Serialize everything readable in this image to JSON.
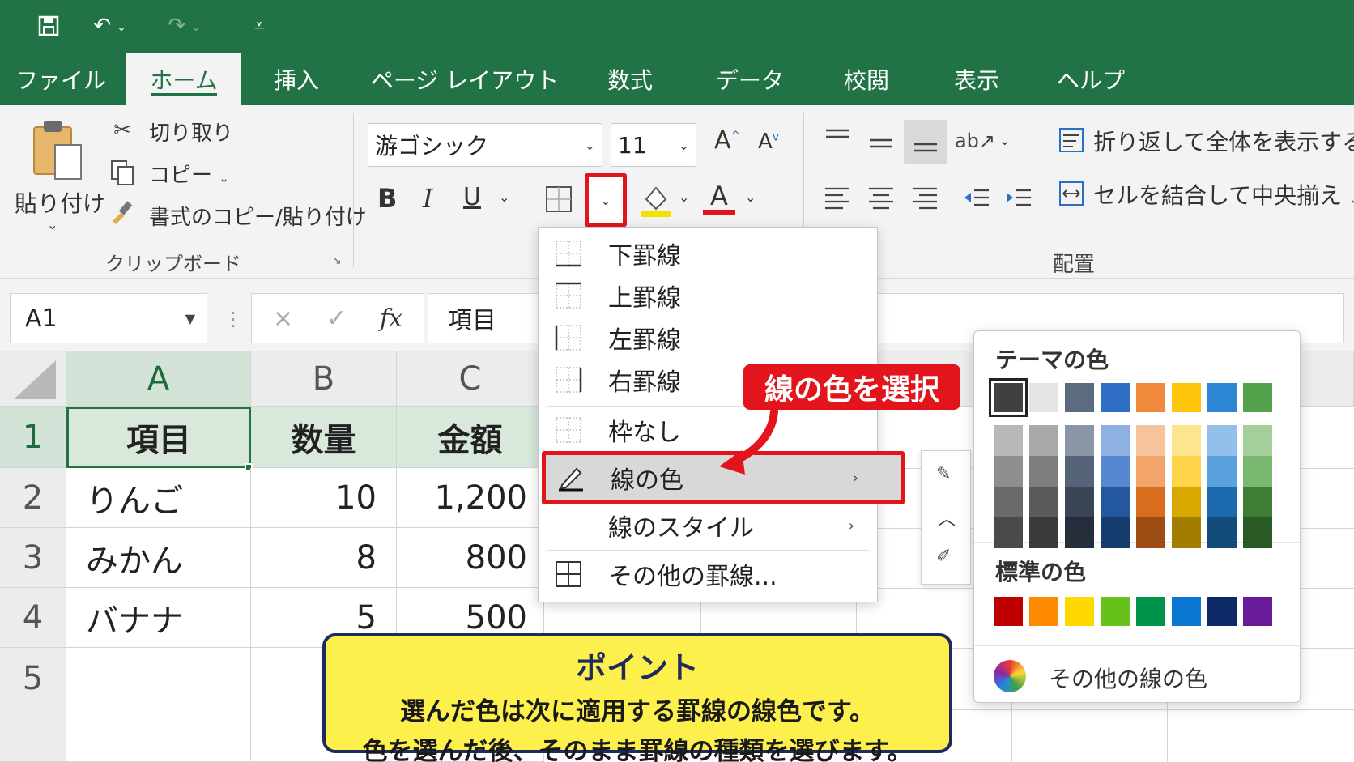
{
  "window": {
    "qat": {
      "save_icon": "save-icon",
      "undo_icon": "undo-icon",
      "redo_icon": "redo-icon",
      "customize_icon": "customize-qat-icon"
    },
    "brand_color": "#217346"
  },
  "tabs": [
    "ファイル",
    "ホーム",
    "挿入",
    "ページ レイアウト",
    "数式",
    "データ",
    "校閲",
    "表示",
    "ヘルプ"
  ],
  "active_tab": "ホーム",
  "ribbon": {
    "clipboard": {
      "paste": "貼り付け",
      "cut": "切り取り",
      "copy": "コピー",
      "format_painter": "書式のコピー/貼り付け",
      "group_label": "クリップボード"
    },
    "font": {
      "font_name": "游ゴシック",
      "font_size": "11",
      "grow": "A",
      "shrink": "A",
      "bold": "B",
      "italic": "I",
      "underline": "U",
      "font_color_glyph": "A"
    },
    "alignment": {
      "wrap_text": "折り返して全体を表示する",
      "merge_center": "セルを結合して中央揃え",
      "group_label": "配置"
    }
  },
  "formula_bar": {
    "name_box": "A1",
    "cancel": "×",
    "enter": "✓",
    "fx": "fx",
    "content": "項目"
  },
  "sheet": {
    "columns": [
      "A",
      "B",
      "C"
    ],
    "rows": [
      "1",
      "2",
      "3",
      "4",
      "5"
    ],
    "data": [
      [
        "項目",
        "数量",
        "金額"
      ],
      [
        "りんご",
        "10",
        "1,200"
      ],
      [
        "みかん",
        "8",
        "800"
      ],
      [
        "バナナ",
        "5",
        "500"
      ]
    ]
  },
  "border_menu": {
    "items": [
      {
        "label": "下罫線",
        "icon": "bottom-border-icon"
      },
      {
        "label": "上罫線",
        "icon": "top-border-icon"
      },
      {
        "label": "左罫線",
        "icon": "left-border-icon"
      },
      {
        "label": "右罫線",
        "icon": "right-border-icon"
      },
      {
        "label": "枠なし",
        "icon": "no-border-icon"
      },
      {
        "label": "線の色",
        "icon": "line-color-icon"
      },
      {
        "label": "線のスタイル",
        "icon": ""
      },
      {
        "label": "その他の罫線...",
        "icon": "all-borders-icon"
      }
    ]
  },
  "color_picker": {
    "theme_title": "テーマの色",
    "standard_title": "標準の色",
    "more_colors": "その他の線の色",
    "theme_top": [
      "#404040",
      "#e4e4e4",
      "#5b6b80",
      "#2f6fc6",
      "#f08a3c",
      "#fdc60b",
      "#2c86d4",
      "#55a24c"
    ],
    "theme_shades": [
      [
        "#b8b8b8",
        "#a8a8a8",
        "#8a95a6",
        "#8fb0e2",
        "#f6c39c",
        "#fde58e",
        "#93c0ea",
        "#a4cf9b"
      ],
      [
        "#8e8e8e",
        "#7e7e7e",
        "#556378",
        "#5588d0",
        "#f2a46a",
        "#fdd44a",
        "#5aa2de",
        "#79b86e"
      ],
      [
        "#6a6a6a",
        "#5a5a5a",
        "#3a4656",
        "#23579e",
        "#d96d1e",
        "#d9a800",
        "#1c6aad",
        "#3e7e37"
      ],
      [
        "#4a4a4a",
        "#3a3a3a",
        "#252e3a",
        "#173d70",
        "#9d4d14",
        "#a27e00",
        "#134b7a",
        "#2a5a26"
      ]
    ],
    "standard": [
      "#c00000",
      "#ff8a00",
      "#ffd800",
      "#66c21a",
      "#00944a",
      "#0a78d2",
      "#0d2a66",
      "#6a1b9a"
    ]
  },
  "annotations": {
    "callout": "線の色を選択",
    "callout_color": "#e3141c",
    "note_title": "ポイント",
    "note_line1": "選んだ色は次に適用する罫線の線色です。",
    "note_line2": "色を選んだ後、そのまま罫線の種類を選びます。"
  }
}
